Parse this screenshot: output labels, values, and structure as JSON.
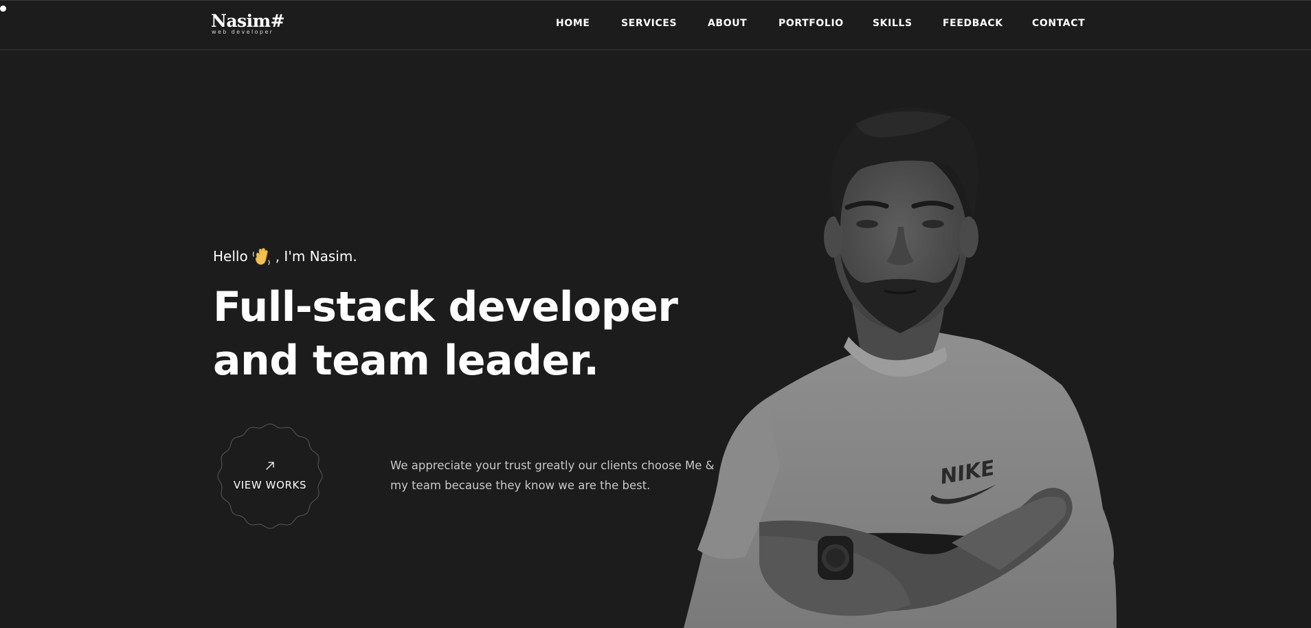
{
  "brand": {
    "name": "Nasim#",
    "tagline": "web developer"
  },
  "nav": {
    "items": [
      {
        "label": "HOME"
      },
      {
        "label": "SERVICES"
      },
      {
        "label": "ABOUT"
      },
      {
        "label": "PORTFOLIO"
      },
      {
        "label": "SKILLS"
      },
      {
        "label": "FEEDBACK"
      },
      {
        "label": "CONTACT"
      }
    ]
  },
  "hero": {
    "greeting_pre": "Hello",
    "greeting_icon": "waving-hand-icon",
    "greeting_post": ", I'm Nasim.",
    "headline_line1": "Full-stack developer",
    "headline_line2": "and team leader.",
    "cta_label": "VIEW WORKS",
    "cta_icon": "arrow-up-right-icon",
    "intro": "We appreciate your trust greatly our clients choose Me & my team because they know we are the best.",
    "portrait_icon": "person-portrait-image"
  },
  "colors": {
    "background": "#1c1c1d",
    "text": "#ffffff",
    "muted_text": "#c9c9c9",
    "ring": "#5a5a5a"
  }
}
